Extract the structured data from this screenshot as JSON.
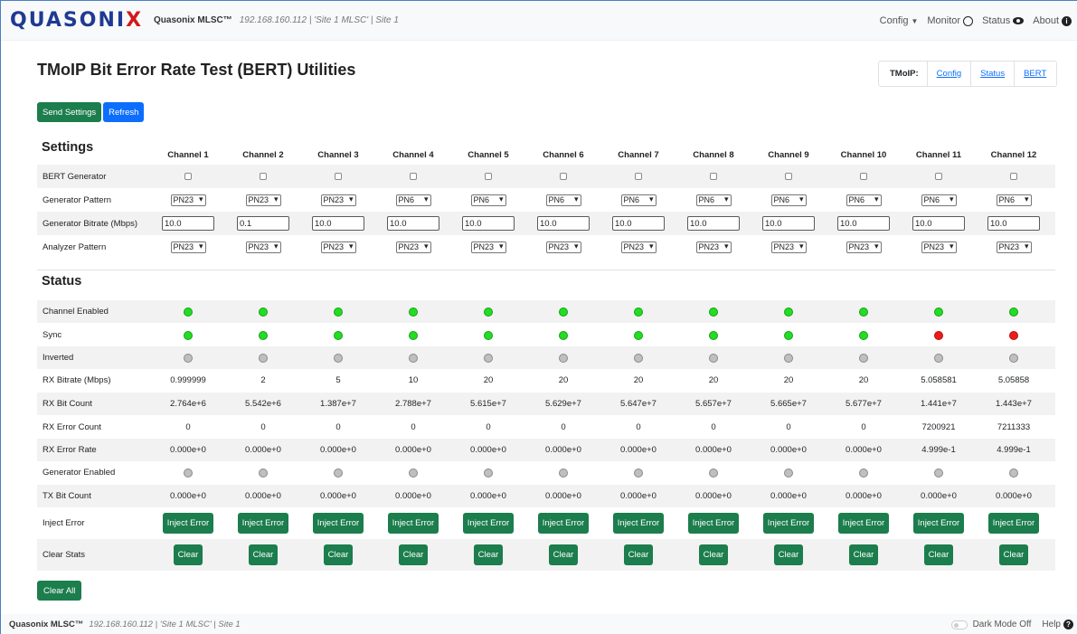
{
  "nav": {
    "logo": "Quasonix",
    "brand": "Quasonix MLSC™",
    "subtitle": "192.168.160.112 | 'Site 1 MLSC' | Site 1",
    "config": "Config",
    "monitor": "Monitor",
    "status": "Status",
    "about": "About"
  },
  "page": {
    "title": "TMoIP Bit Error Rate Test (BERT) Utilities",
    "tmoip_label": "TMoIP:",
    "links": [
      "Config",
      "Status",
      "BERT"
    ],
    "send_settings": "Send Settings",
    "refresh": "Refresh",
    "clear_all": "Clear All"
  },
  "channels": [
    "Channel 1",
    "Channel 2",
    "Channel 3",
    "Channel 4",
    "Channel 5",
    "Channel 6",
    "Channel 7",
    "Channel 8",
    "Channel 9",
    "Channel 10",
    "Channel 11",
    "Channel 12"
  ],
  "settings": {
    "heading": "Settings",
    "rows": [
      {
        "label": "BERT Generator",
        "type": "checkbox",
        "values": [
          "",
          "",
          "",
          "",
          "",
          "",
          "",
          "",
          "",
          "",
          "",
          ""
        ]
      },
      {
        "label": "Generator Pattern",
        "type": "select",
        "values": [
          "PN23",
          "PN23",
          "PN23",
          "PN6",
          "PN6",
          "PN6",
          "PN6",
          "PN6",
          "PN6",
          "PN6",
          "PN6",
          "PN6"
        ]
      },
      {
        "label": "Generator Bitrate (Mbps)",
        "type": "input",
        "values": [
          "10.0",
          "0.1",
          "10.0",
          "10.0",
          "10.0",
          "10.0",
          "10.0",
          "10.0",
          "10.0",
          "10.0",
          "10.0",
          "10.0"
        ]
      },
      {
        "label": "Analyzer Pattern",
        "type": "select",
        "values": [
          "PN23",
          "PN23",
          "PN23",
          "PN23",
          "PN23",
          "PN23",
          "PN23",
          "PN23",
          "PN23",
          "PN23",
          "PN23",
          "PN23"
        ]
      }
    ]
  },
  "status": {
    "heading": "Status",
    "rows": [
      {
        "label": "Channel Enabled",
        "type": "dot",
        "values": [
          "green",
          "green",
          "green",
          "green",
          "green",
          "green",
          "green",
          "green",
          "green",
          "green",
          "green",
          "green"
        ]
      },
      {
        "label": "Sync",
        "type": "dot",
        "values": [
          "green",
          "green",
          "green",
          "green",
          "green",
          "green",
          "green",
          "green",
          "green",
          "green",
          "red",
          "red"
        ]
      },
      {
        "label": "Inverted",
        "type": "dot",
        "values": [
          "gray",
          "gray",
          "gray",
          "gray",
          "gray",
          "gray",
          "gray",
          "gray",
          "gray",
          "gray",
          "gray",
          "gray"
        ]
      },
      {
        "label": "RX Bitrate (Mbps)",
        "type": "text",
        "values": [
          "0.999999",
          "2",
          "5",
          "10",
          "20",
          "20",
          "20",
          "20",
          "20",
          "20",
          "5.058581",
          "5.05858"
        ]
      },
      {
        "label": "RX Bit Count",
        "type": "text",
        "values": [
          "2.764e+6",
          "5.542e+6",
          "1.387e+7",
          "2.788e+7",
          "5.615e+7",
          "5.629e+7",
          "5.647e+7",
          "5.657e+7",
          "5.665e+7",
          "5.677e+7",
          "1.441e+7",
          "1.443e+7"
        ]
      },
      {
        "label": "RX Error Count",
        "type": "text",
        "values": [
          "0",
          "0",
          "0",
          "0",
          "0",
          "0",
          "0",
          "0",
          "0",
          "0",
          "7200921",
          "7211333"
        ]
      },
      {
        "label": "RX Error Rate",
        "type": "text",
        "values": [
          "0.000e+0",
          "0.000e+0",
          "0.000e+0",
          "0.000e+0",
          "0.000e+0",
          "0.000e+0",
          "0.000e+0",
          "0.000e+0",
          "0.000e+0",
          "0.000e+0",
          "4.999e-1",
          "4.999e-1"
        ]
      },
      {
        "label": "Generator Enabled",
        "type": "dot",
        "values": [
          "gray",
          "gray",
          "gray",
          "gray",
          "gray",
          "gray",
          "gray",
          "gray",
          "gray",
          "gray",
          "gray",
          "gray"
        ]
      },
      {
        "label": "TX Bit Count",
        "type": "text",
        "values": [
          "0.000e+0",
          "0.000e+0",
          "0.000e+0",
          "0.000e+0",
          "0.000e+0",
          "0.000e+0",
          "0.000e+0",
          "0.000e+0",
          "0.000e+0",
          "0.000e+0",
          "0.000e+0",
          "0.000e+0"
        ]
      },
      {
        "label": "Inject Error",
        "type": "button",
        "values": [
          "Inject Error",
          "Inject Error",
          "Inject Error",
          "Inject Error",
          "Inject Error",
          "Inject Error",
          "Inject Error",
          "Inject Error",
          "Inject Error",
          "Inject Error",
          "Inject Error",
          "Inject Error"
        ]
      },
      {
        "label": "Clear Stats",
        "type": "button",
        "values": [
          "Clear",
          "Clear",
          "Clear",
          "Clear",
          "Clear",
          "Clear",
          "Clear",
          "Clear",
          "Clear",
          "Clear",
          "Clear",
          "Clear"
        ]
      }
    ]
  },
  "footer": {
    "brand": "Quasonix MLSC™",
    "subtitle": "192.168.160.112 | 'Site 1 MLSC' | Site 1",
    "dark_mode": "Dark Mode Off",
    "help": "Help"
  },
  "colors": {
    "accent_green": "#1c7d4d",
    "accent_blue": "#0d6efd",
    "logo_blue": "#1f3a93",
    "logo_red": "#d11a1a"
  }
}
